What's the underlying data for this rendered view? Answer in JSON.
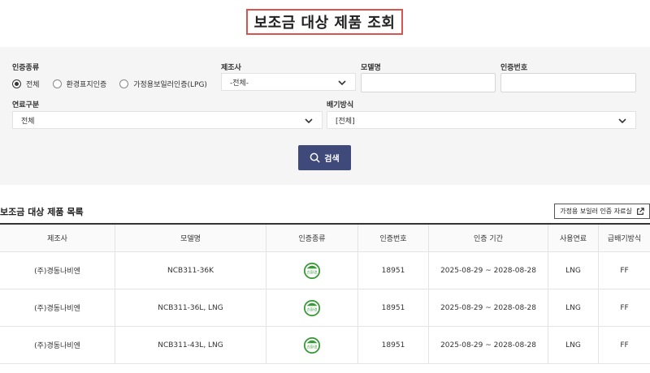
{
  "page": {
    "title": "보조금 대상 제품 조회"
  },
  "filters": {
    "cert_type_label": "인증종류",
    "cert_type_options": [
      "전체",
      "환경표지인증",
      "가정용보일러인증(LPG)"
    ],
    "cert_type_selected": 0,
    "manufacturer_label": "제조사",
    "manufacturer_value": "-전체-",
    "model_label": "모델명",
    "model_value": "",
    "cert_number_label": "인증번호",
    "cert_number_value": "",
    "fuel_label": "연료구분",
    "fuel_value": "전체",
    "exhaust_label": "배기방식",
    "exhaust_value": "[전체]",
    "search_label": "검색"
  },
  "list": {
    "title": "보조금 대상 제품 목록",
    "archive_label": "가정용 보일러 인증 자료실",
    "columns": [
      "제조사",
      "모델명",
      "인증종류",
      "인증번호",
      "인증 기간",
      "사용연료",
      "급배기방식"
    ],
    "badge_text": "친환경",
    "rows": [
      {
        "manufacturer": "(주)경동나비엔",
        "model": "NCB311-36K",
        "cert_icon": "eco-label-icon",
        "cert_no": "18951",
        "period": "2025-08-29 ~ 2028-08-28",
        "fuel": "LNG",
        "exhaust": "FF"
      },
      {
        "manufacturer": "(주)경동나비엔",
        "model": "NCB311-36L, LNG",
        "cert_icon": "eco-label-icon",
        "cert_no": "18951",
        "period": "2025-08-29 ~ 2028-08-28",
        "fuel": "LNG",
        "exhaust": "FF"
      },
      {
        "manufacturer": "(주)경동나비엔",
        "model": "NCB311-43L, LNG",
        "cert_icon": "eco-label-icon",
        "cert_no": "18951",
        "period": "2025-08-29 ~ 2028-08-28",
        "fuel": "LNG",
        "exhaust": "FF"
      }
    ]
  },
  "colors": {
    "accent": "#3f4a7a",
    "title_border": "#d9534f",
    "eco_green": "#3a9a3a"
  }
}
